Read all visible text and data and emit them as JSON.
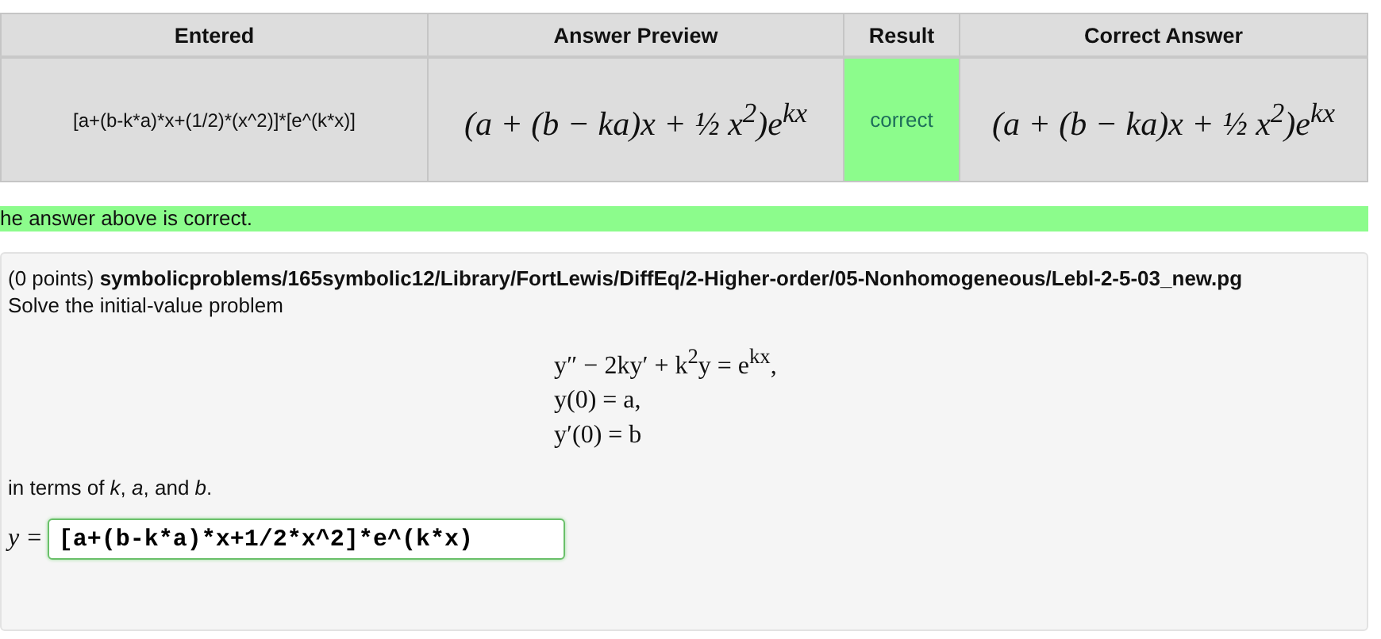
{
  "results_table": {
    "columns": [
      "Entered",
      "Answer Preview",
      "Result",
      "Correct Answer"
    ],
    "rows": [
      {
        "entered": "[a+(b-k*a)*x+(1/2)*(x^2)]*[e^(k*x)]",
        "preview": "(a + (b − ka)x + ½ x$^{2}$)e$^{kx}$",
        "result": "correct",
        "correct": true,
        "correct_answer": "(a + (b − ka)x + ½ x$^{2}$)e$^{kx}$"
      }
    ]
  },
  "message": {
    "text": "he answer above is correct.",
    "correct": true
  },
  "problem": {
    "intro": "(0 points) **symbolicproblems/165symbolic12/Library/FortLewis/DiffEq/2-Higher-order/05-Nonhomogeneous/Lebl-2-5-03_new.pg**",
    "prompt": "Solve the initial-value problem",
    "equations": [
      "y″ − 2ky′ + k$^{2}$y = e$^{kx}$,",
      "y(0) = a,",
      "y′(0) = b"
    ],
    "terms": "in terms of *k*, *a*, and *b*.",
    "answer_label": "y =",
    "answer_value": "[a+(b-k*a)*x+1/2*x^2]*e^(k*x)"
  }
}
